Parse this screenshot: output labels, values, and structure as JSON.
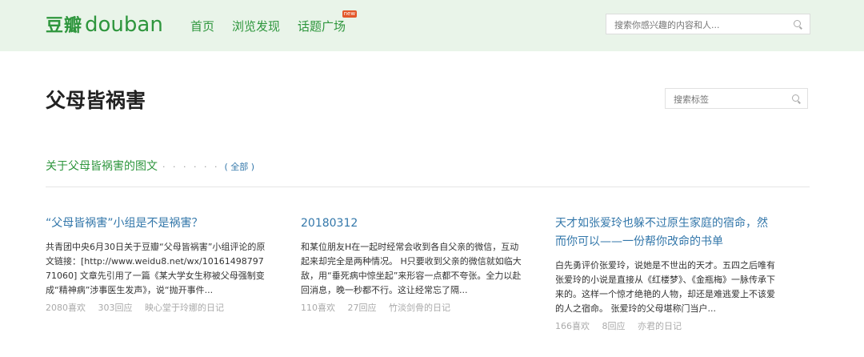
{
  "header": {
    "logo_cn": "豆瓣",
    "logo_en": "douban",
    "nav": [
      {
        "label": "首页"
      },
      {
        "label": "浏览发现"
      },
      {
        "label": "话题广场",
        "badge": "new"
      }
    ],
    "search_placeholder": "搜索你感兴趣的内容和人..."
  },
  "page": {
    "title": "父母皆祸害",
    "tag_search_placeholder": "搜索标签"
  },
  "section": {
    "title": "关于父母皆祸害的图文",
    "dots": "· · · · · ·",
    "all_link": "( 全部 )"
  },
  "articles": [
    {
      "title": "“父母皆祸害”小组是不是祸害？",
      "body": "共青团中央6月30日关于豆瓣“父母皆祸害”小组评论的原文链接：[http://www.weidu8.net/wx/1016149879771060] 文章先引用了一篇《某大学女生称被父母强制变成“精神病”涉事医生发声》，说“抛开事件...",
      "likes": "2080喜欢",
      "replies": "303回应",
      "author": "映心堂于玲娜的日记"
    },
    {
      "title": "20180312",
      "body": "和某位朋友H在一起时经常会收到各自父亲的微信，互动起来却完全是两种情况。 H只要收到父亲的微信就如临大敌，用“垂死病中惊坐起”来形容一点都不夸张。全力以赴回消息，晚一秒都不行。这让经常忘了隔...",
      "likes": "110喜欢",
      "replies": "27回应",
      "author": "竹淡剑骨的日记"
    },
    {
      "title": "天才如张爱玲也躲不过原生家庭的宿命，然而你可以——一份帮你改命的书单",
      "body": "白先勇评价张爱玲，说她是不世出的天才。五四之后唯有张爱玲的小说是直接从《红楼梦》、《金瓶梅》一脉传承下来的。这样一个惊才绝艳的人物，却还是难逃爱上不该爱的人之宿命。 张爱玲的父母堪称门当户...",
      "likes": "166喜欢",
      "replies": "8回应",
      "author": "亦君的日记"
    }
  ],
  "colors": {
    "brand_green": "#2e963d",
    "link_blue": "#3377aa",
    "header_bg": "#e9f4e9"
  }
}
